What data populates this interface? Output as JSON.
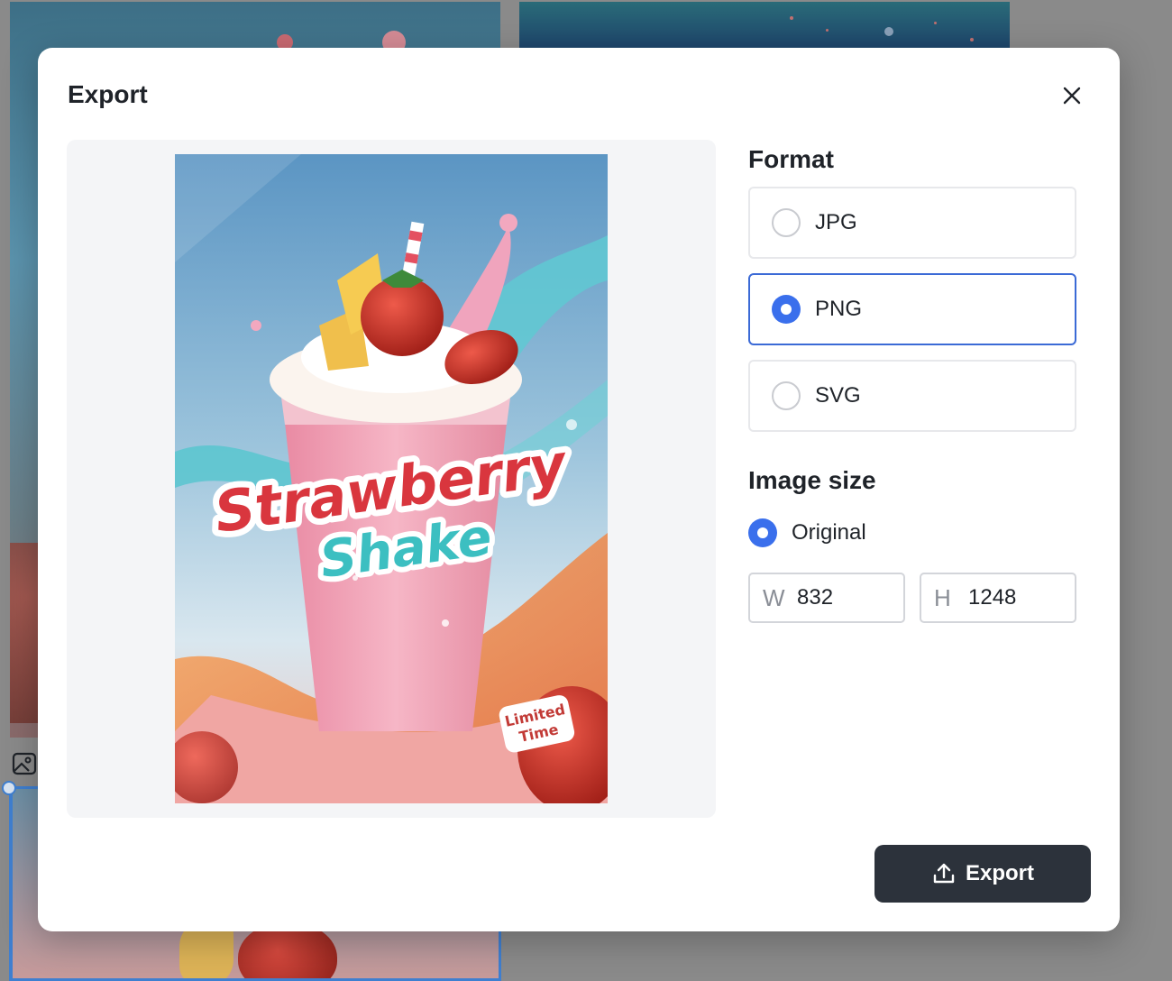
{
  "modal": {
    "title": "Export",
    "close_icon": "close-icon"
  },
  "preview": {
    "poster": {
      "headline_line1": "Strawberry",
      "headline_line2": "Shake",
      "badge_line1": "Limited",
      "badge_line2": "Time"
    }
  },
  "format": {
    "heading": "Format",
    "options": [
      {
        "label": "JPG",
        "selected": false
      },
      {
        "label": "PNG",
        "selected": true
      },
      {
        "label": "SVG",
        "selected": false
      }
    ]
  },
  "image_size": {
    "heading": "Image size",
    "original_label": "Original",
    "original_selected": true,
    "width_prefix": "W",
    "width_value": "832",
    "height_prefix": "H",
    "height_value": "1248"
  },
  "actions": {
    "export_label": "Export",
    "export_icon": "upload-icon"
  },
  "colors": {
    "accent": "#3a6fec",
    "selected_border": "#3b6ad6",
    "primary_button": "#2c323b",
    "text": "#1f2329"
  }
}
